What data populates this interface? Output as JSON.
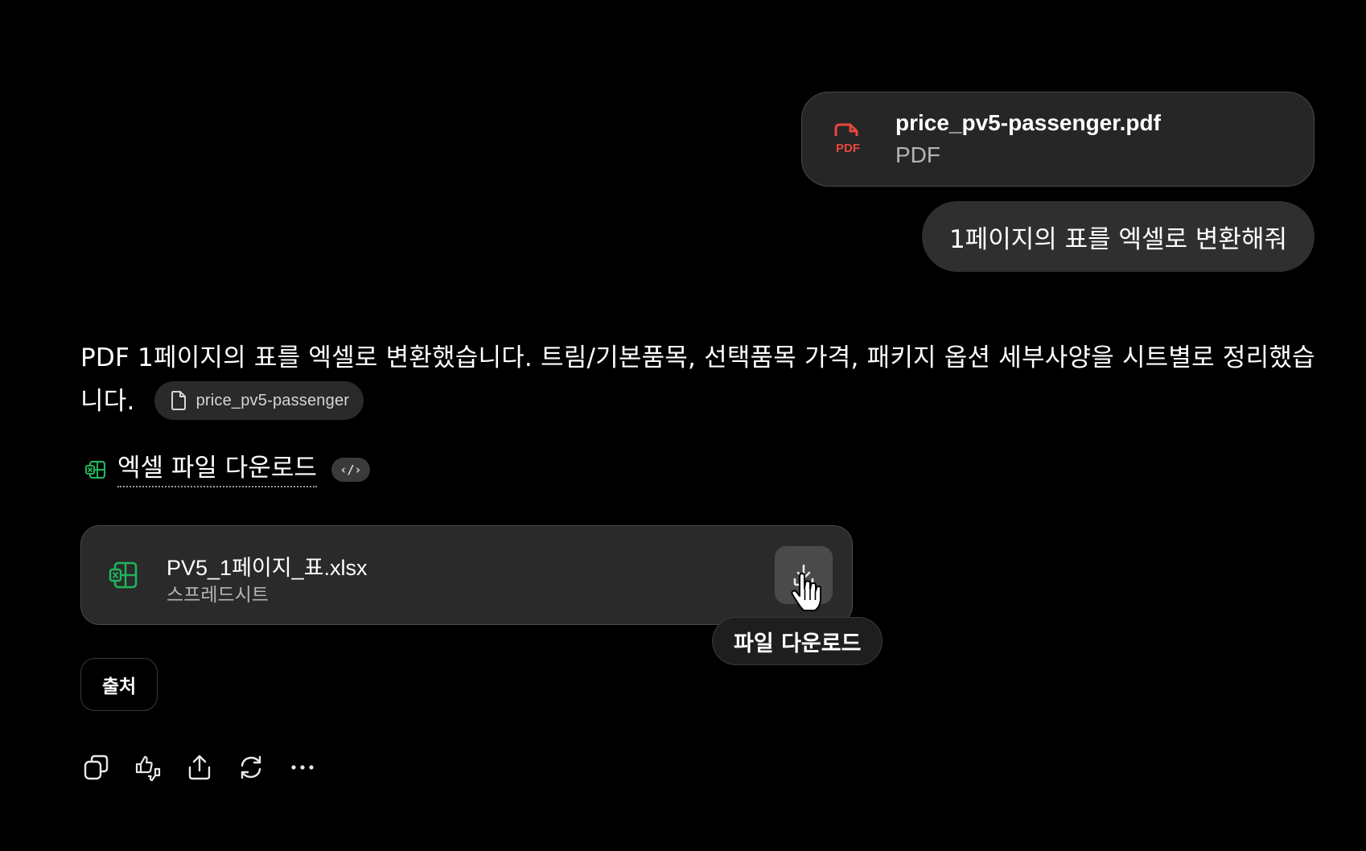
{
  "user_attachment": {
    "file_name": "price_pv5-passenger.pdf",
    "file_type": "PDF",
    "icon": "pdf-file-icon",
    "icon_label": "PDF",
    "accent_color": "#e5483c"
  },
  "user_message": {
    "text": "1페이지의 표를 엑셀로 변환해줘"
  },
  "assistant": {
    "text": "PDF 1페이지의 표를 엑셀로 변환했습니다. 트림/기본품목, 선택품목 가격, 패키지 옵션 세부사양을 시트별로 정리했습니다.",
    "source_chip": {
      "label": "price_pv5-passenger",
      "icon": "document-icon"
    },
    "download_link": {
      "label": "엑셀 파일 다운로드",
      "icon": "spreadsheet-icon",
      "code_toggle_label": "‹/›",
      "accent_color": "#1fb45c"
    },
    "file_card": {
      "name": "PV5_1페이지_표.xlsx",
      "type": "스프레드시트",
      "icon": "spreadsheet-icon",
      "download_icon": "download-icon"
    },
    "tooltip": "파일 다운로드",
    "sources_label": "출처",
    "actions": [
      {
        "name": "copy",
        "icon": "copy-icon"
      },
      {
        "name": "feedback",
        "icon": "thumbs-up-down-icon"
      },
      {
        "name": "share",
        "icon": "share-icon"
      },
      {
        "name": "regenerate",
        "icon": "refresh-icon"
      },
      {
        "name": "more",
        "icon": "more-icon"
      }
    ]
  }
}
